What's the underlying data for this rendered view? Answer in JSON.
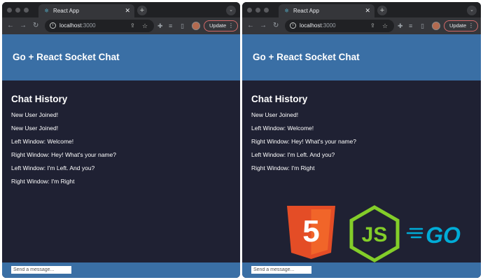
{
  "windows": [
    {
      "tab": {
        "title": "React App"
      },
      "address": {
        "host": "localhost",
        "port": ":3000"
      },
      "update_label": "Update",
      "header": {
        "title": "Go + React Socket Chat"
      },
      "history": {
        "title": "Chat History",
        "messages": [
          "New User Joined!",
          "New User Joined!",
          "Left Window: Welcome!",
          "Right Window: Hey! What's your name?",
          "Left Window: I'm Left. And you?",
          "Right Window: I'm Right"
        ]
      },
      "input": {
        "placeholder": "Send a message..."
      }
    },
    {
      "tab": {
        "title": "React App"
      },
      "address": {
        "host": "localhost",
        "port": ":3000"
      },
      "update_label": "Update",
      "header": {
        "title": "Go + React Socket Chat"
      },
      "history": {
        "title": "Chat History",
        "messages": [
          "New User Joined!",
          "Left Window: Welcome!",
          "Right Window: Hey! What's your name?",
          "Left Window: I'm Left. And you?",
          "Right Window: I'm Right"
        ]
      },
      "input": {
        "placeholder": "Send a message..."
      }
    }
  ],
  "logos": {
    "html5": {
      "digit": "5",
      "color": "#e44d26",
      "color_light": "#f16529"
    },
    "nodejs": {
      "text": "JS",
      "color": "#83cd29"
    },
    "go": {
      "text": "GO",
      "color": "#00acd7"
    }
  },
  "theme": {
    "header_bg": "#3a6fa5",
    "body_bg": "#1f2133",
    "chrome_dark": "#202124",
    "chrome_toolbar": "#35363a"
  }
}
